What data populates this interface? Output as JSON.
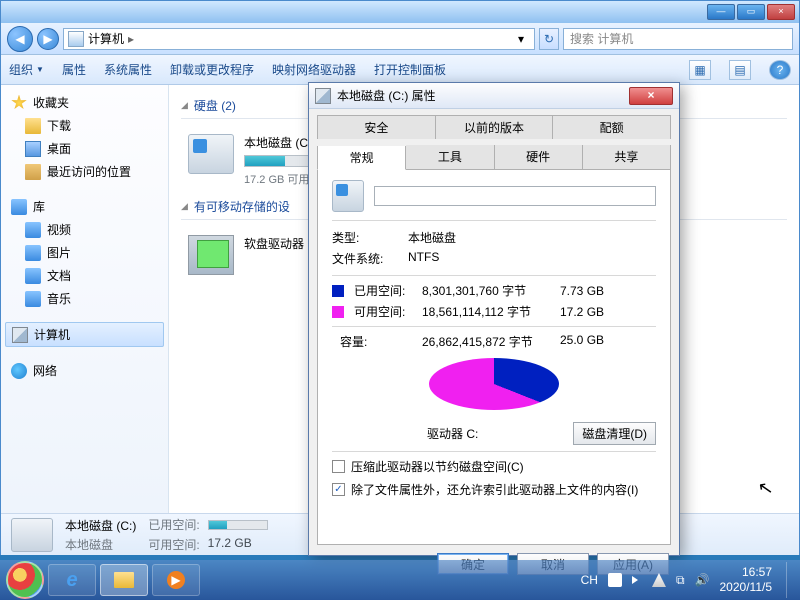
{
  "window": {
    "min": "—",
    "max": "▭",
    "close": "×"
  },
  "nav": {
    "back": "◀",
    "fwd": "▶",
    "location": "计算机",
    "sep": "▸",
    "drop": "▾",
    "refresh": "↻",
    "search_placeholder": "搜索 计算机"
  },
  "toolbar": {
    "organize": "组织",
    "drop": "▼",
    "properties": "属性",
    "sysprops": "系统属性",
    "uninstall": "卸载或更改程序",
    "mapdrive": "映射网络驱动器",
    "controlpanel": "打开控制面板",
    "view_icon": "▦",
    "pane_icon": "▤",
    "help_icon": "?"
  },
  "sidebar": {
    "fav": "收藏夹",
    "downloads": "下载",
    "desktop": "桌面",
    "recent": "最近访问的位置",
    "lib": "库",
    "videos": "视频",
    "pictures": "图片",
    "documents": "文档",
    "music": "音乐",
    "computer": "计算机",
    "network": "网络"
  },
  "content": {
    "tri": "◢",
    "hdd_header": "硬盘 (2)",
    "removable_header": "有可移动存储的设",
    "drive_c": {
      "name": "本地磁盘 (C:)",
      "free_text": "17.2 GB 可用",
      "usage_pct": 31
    },
    "floppy": {
      "name": "软盘驱动器 ("
    }
  },
  "statusbar": {
    "title": "本地磁盘 (C:)",
    "used_label": "已用空间:",
    "free_label": "可用空间:",
    "free_value": "17.2 GB"
  },
  "dialog": {
    "title": "本地磁盘 (C:) 属性",
    "close": "×",
    "tabs_top": [
      "安全",
      "以前的版本",
      "配额"
    ],
    "tabs_bottom": [
      "常规",
      "工具",
      "硬件",
      "共享"
    ],
    "name_value": "",
    "type_label": "类型:",
    "type_value": "本地磁盘",
    "fs_label": "文件系统:",
    "fs_value": "NTFS",
    "used_label": "已用空间:",
    "used_bytes": "8,301,301,760 字节",
    "used_gb": "7.73 GB",
    "free_label": "可用空间:",
    "free_bytes": "18,561,114,112 字节",
    "free_gb": "17.2 GB",
    "cap_label": "容量:",
    "cap_bytes": "26,862,415,872 字节",
    "cap_gb": "25.0 GB",
    "drive_label": "驱动器 C:",
    "cleanup": "磁盘清理(D)",
    "compress": "压缩此驱动器以节约磁盘空间(C)",
    "index": "除了文件属性外，还允许索引此驱动器上文件的内容(I)",
    "index_checked": "✓",
    "ok": "确定",
    "cancel": "取消",
    "apply": "应用(A)"
  },
  "taskbar": {
    "lang": "CH",
    "time": "16:57",
    "date": "2020/11/5"
  },
  "chart_data": {
    "type": "pie",
    "title": "驱动器 C:",
    "series": [
      {
        "name": "已用空间",
        "value": 8301301760,
        "display": "7.73 GB",
        "color": "#0020c0"
      },
      {
        "name": "可用空间",
        "value": 18561114112,
        "display": "17.2 GB",
        "color": "#f020f0"
      }
    ],
    "total": {
      "name": "容量",
      "value": 26862415872,
      "display": "25.0 GB"
    }
  }
}
